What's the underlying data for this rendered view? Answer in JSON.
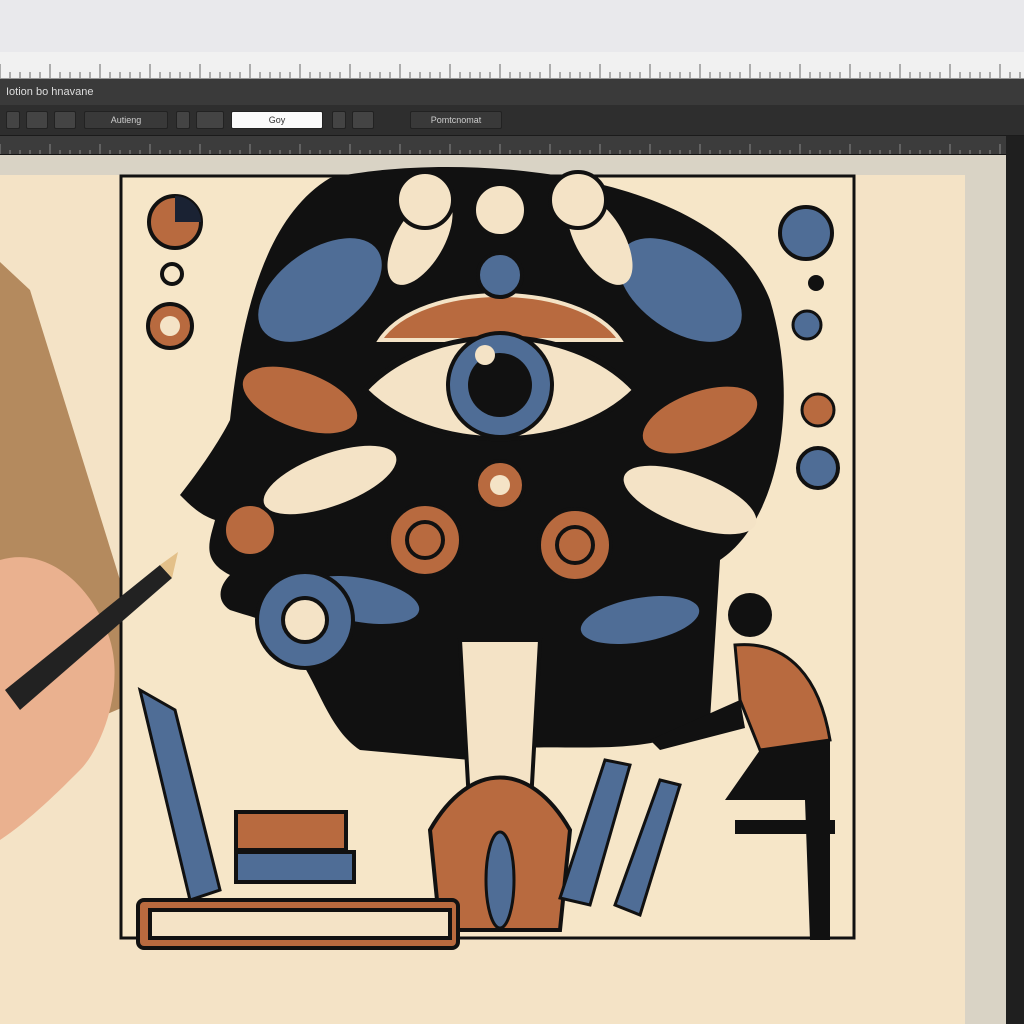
{
  "menubar": {
    "title_text": "Iotion bo hnavane"
  },
  "toolbar": {
    "mode_label": "Autieng",
    "field_value": "Goy",
    "preset_label": "Pomtcnomat"
  },
  "artwork": {
    "name": "mind-eye-illustration",
    "palette": {
      "cream": "#f4e3c6",
      "navy": "#1a2233",
      "blue": "#4f6d96",
      "rust": "#b86a3f",
      "ink": "#111111"
    }
  }
}
